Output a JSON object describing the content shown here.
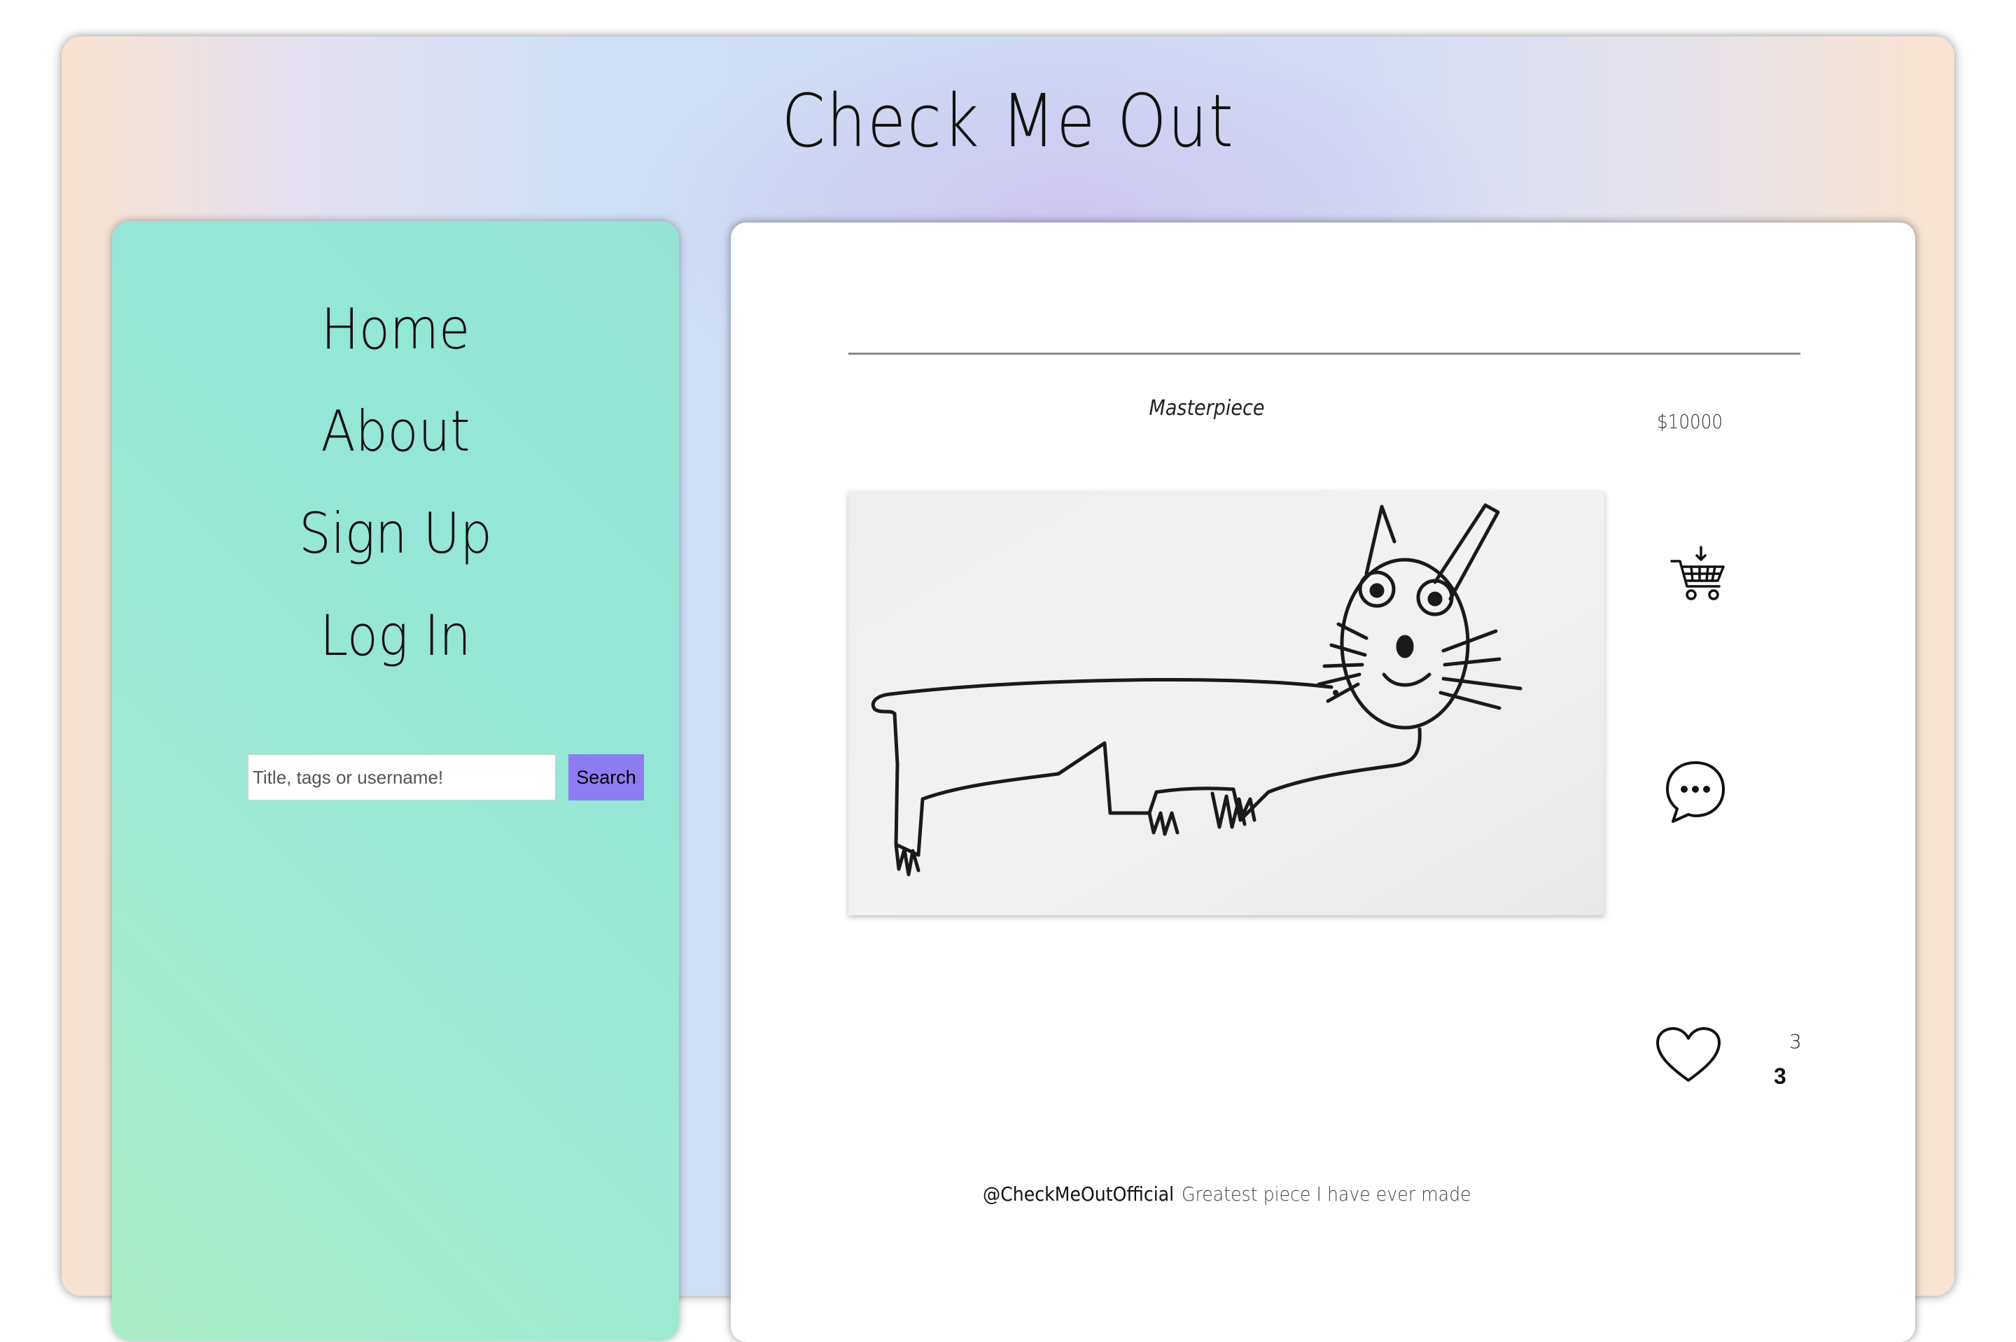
{
  "header": {
    "title": "Check Me Out"
  },
  "sidebar": {
    "nav": [
      {
        "label": "Home"
      },
      {
        "label": "About"
      },
      {
        "label": "Sign Up"
      },
      {
        "label": "Log In"
      }
    ],
    "search": {
      "placeholder": "Title, tags or username!",
      "value": "",
      "button_label": "Search"
    }
  },
  "post": {
    "title": "Masterpiece",
    "price": "$10000",
    "image_alt": "Child-style drawing of a long cat",
    "likes": "3",
    "likes_total": "3",
    "username": "@CheckMeOutOfficial",
    "description": "Greatest piece I have ever made",
    "icons": {
      "cart": "shopping-cart-icon",
      "comment": "comment-bubble-icon",
      "like": "heart-icon"
    }
  },
  "colors": {
    "search_button": "#8d7cf0",
    "sidebar_from": "#abecc6",
    "sidebar_to": "#94e6d6"
  }
}
